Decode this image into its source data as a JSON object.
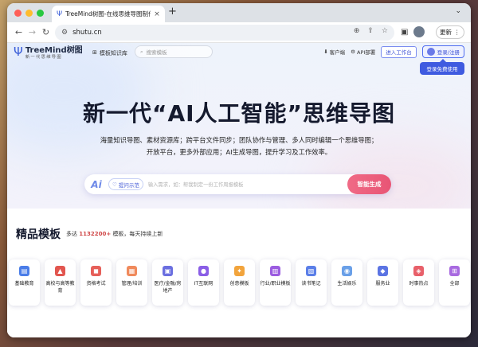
{
  "browser": {
    "tab_title": "TreeMind树图-在线思维导图制作",
    "tab_close": "×",
    "new_tab": "+",
    "tab_menu": "⌄",
    "url": "shutu.cn",
    "update_label": "更新",
    "traffic_colors": [
      "#fe5f57",
      "#febc2e",
      "#28c840"
    ]
  },
  "header": {
    "logo_name": "TreeMind树图",
    "logo_tagline": "新一代思维导图",
    "template_lib": "模板知识库",
    "search_placeholder": "搜索模板",
    "client_label": "客户端",
    "api_label": "API部署",
    "enter_workspace": "进入工作台",
    "login_label": "登录/注册",
    "login_tooltip": "登录免费使用"
  },
  "hero": {
    "title": "新一代“AI人工智能”思维导图",
    "desc_line1": "海量知识导图、素材资源库；跨平台文件同步；团队协作与管理、多人同时编辑一个思维导图；",
    "desc_line2": "开放平台，更多外部应用；AI生成导图，提升学习及工作效率。"
  },
  "ai_bar": {
    "icon_text": "Ai",
    "example_chip": "提问示范",
    "placeholder": "输入需求，如：帮我制定一份工作周报模板",
    "generate_label": "智能生成"
  },
  "templates": {
    "title": "精品模板",
    "sub_prefix": "多达",
    "count": "1132200+",
    "sub_suffix": "模板，每天持续上新",
    "categories": [
      {
        "label": "基础教育",
        "color": "#4a7de8",
        "glyph": "▤"
      },
      {
        "label": "高校与高等教育",
        "color": "#e2564f",
        "glyph": "▲"
      },
      {
        "label": "资格考试",
        "color": "#e6605a",
        "glyph": "◼"
      },
      {
        "label": "管理/培训",
        "color": "#f08a5c",
        "glyph": "▦"
      },
      {
        "label": "医疗/金融/房地产",
        "color": "#6b6fe0",
        "glyph": "▣"
      },
      {
        "label": "IT互联网",
        "color": "#8a5ee6",
        "glyph": "●"
      },
      {
        "label": "创意模板",
        "color": "#f2a43c",
        "glyph": "✦"
      },
      {
        "label": "行业/职业模板",
        "color": "#9b5ce0",
        "glyph": "▥"
      },
      {
        "label": "读书笔记",
        "color": "#5b7fe8",
        "glyph": "▧"
      },
      {
        "label": "生活娱乐",
        "color": "#6aa0e8",
        "glyph": "◉"
      },
      {
        "label": "服务业",
        "color": "#5b74e3",
        "glyph": "◆"
      },
      {
        "label": "时事热点",
        "color": "#e8606a",
        "glyph": "◈"
      },
      {
        "label": "全部",
        "color": "#a86ae0",
        "glyph": "⊞"
      }
    ]
  }
}
